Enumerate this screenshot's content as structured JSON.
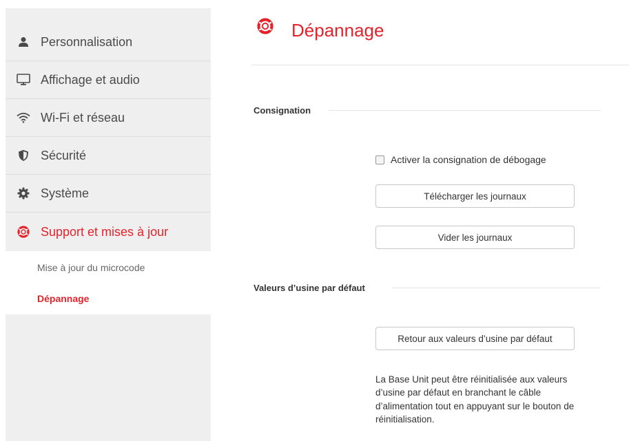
{
  "sidebar": {
    "items": [
      {
        "label": "Personnalisation",
        "icon": "person-icon"
      },
      {
        "label": "Affichage et audio",
        "icon": "monitor-icon"
      },
      {
        "label": "Wi-Fi et réseau",
        "icon": "wifi-icon"
      },
      {
        "label": "Sécurité",
        "icon": "shield-icon"
      },
      {
        "label": "Système",
        "icon": "gear-icon"
      },
      {
        "label": "Support et mises à jour",
        "icon": "lifebuoy-icon",
        "active": true
      }
    ],
    "subitems": [
      {
        "label": "Mise à jour du microcode"
      },
      {
        "label": "Dépannage",
        "active": true
      }
    ]
  },
  "page": {
    "title": "Dépannage",
    "icon": "lifebuoy-icon",
    "accent_color": "#e3232b"
  },
  "logging": {
    "section_title": "Consignation",
    "debug_checkbox_label": "Activer la consignation de débogage",
    "debug_checked": false,
    "download_button": "Télécharger les journaux",
    "clear_button": "Vider les journaux"
  },
  "factory": {
    "section_title": "Valeurs d’usine par défaut",
    "reset_button": "Retour aux valeurs d’usine par défaut",
    "info_text": "La Base Unit peut être réinitialisée aux valeurs d’usine par défaut en branchant le câble d’alimentation tout en appuyant sur le bouton de réinitialisation."
  }
}
